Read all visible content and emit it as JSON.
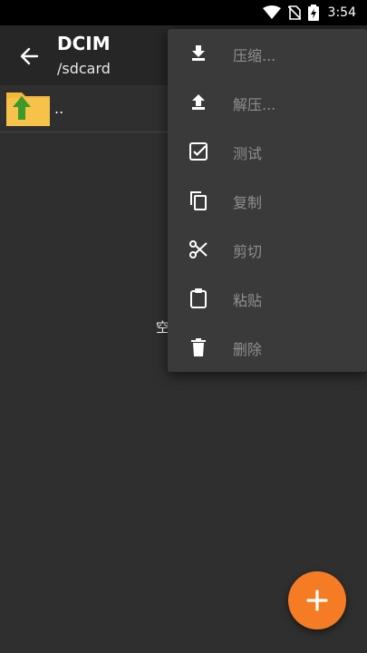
{
  "status_bar": {
    "time": "3:54",
    "icons": [
      "wifi-icon",
      "no-sim-icon",
      "battery-charging-icon"
    ]
  },
  "app_bar": {
    "title": "DCIM",
    "subtitle": "/sdcard",
    "back_icon": "back-arrow-icon"
  },
  "list": {
    "items": [
      {
        "label": "..",
        "icon": "folder-up-icon"
      }
    ]
  },
  "empty_text": "空",
  "menu": {
    "items": [
      {
        "label": "压缩...",
        "icon": "download-icon"
      },
      {
        "label": "解压...",
        "icon": "upload-icon"
      },
      {
        "label": "测试",
        "icon": "checkbox-icon"
      },
      {
        "label": "复制",
        "icon": "copy-icon"
      },
      {
        "label": "剪切",
        "icon": "scissors-icon"
      },
      {
        "label": "粘贴",
        "icon": "clipboard-icon"
      },
      {
        "label": "删除",
        "icon": "trash-icon"
      }
    ]
  },
  "fab": {
    "icon": "plus-icon"
  },
  "colors": {
    "accent": "#f57c24",
    "background": "#2f2f2f",
    "app_bar": "#262626",
    "menu_background": "#3a3a3a",
    "folder": "#f5b83a",
    "folder_arrow": "#3c9a2a"
  }
}
